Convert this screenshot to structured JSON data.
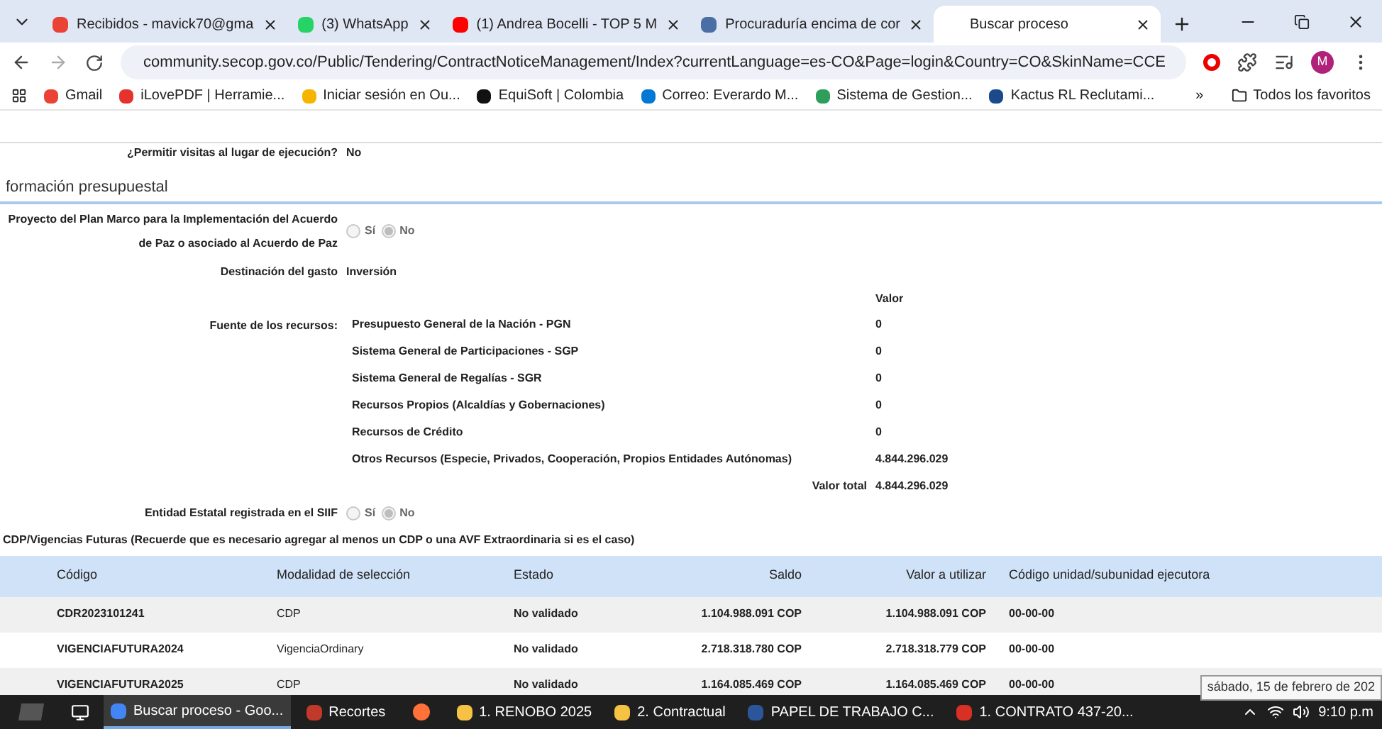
{
  "browser": {
    "tabs": [
      {
        "title": "Recibidos - mavick70@gma",
        "selected": false
      },
      {
        "title": "(3) WhatsApp",
        "selected": false
      },
      {
        "title": "(1) Andrea Bocelli - TOP 5 M",
        "selected": false
      },
      {
        "title": "Procuraduría encima de cor",
        "selected": false
      },
      {
        "title": "Buscar proceso",
        "selected": true
      }
    ],
    "url": "community.secop.gov.co/Public/Tendering/ContractNoticeManagement/Index?currentLanguage=es-CO&Page=login&Country=CO&SkinName=CCE",
    "profile_initial": "M",
    "bookmarks": [
      "Gmail",
      "iLovePDF | Herramie...",
      "Iniciar sesión en Ou...",
      "EquiSoft | Colombia",
      "Correo: Everardo M...",
      "Sistema de Gestion...",
      "Kactus RL Reclutami..."
    ],
    "more_bookmarks": "»",
    "all_bookmarks": "Todos los favoritos"
  },
  "page": {
    "visits": {
      "label": "¿Permitir visitas al lugar de ejecución?",
      "value": "No"
    },
    "section_title": "formación presupuestal",
    "peace_plan": {
      "label_lines": [
        "Proyecto del Plan Marco para la Implementación del Acuerdo",
        "de Paz o asociado al Acuerdo de Paz"
      ],
      "options": [
        {
          "label": "Sí",
          "selected": false
        },
        {
          "label": "No",
          "selected": true
        }
      ]
    },
    "destination": {
      "label": "Destinación del gasto",
      "value": "Inversión"
    },
    "sources": {
      "label": "Fuente de los recursos:",
      "value_header": "Valor",
      "items": [
        {
          "name": "Presupuesto General de la Nación - PGN",
          "value": "0"
        },
        {
          "name": "Sistema General de Participaciones - SGP",
          "value": "0"
        },
        {
          "name": "Sistema General de Regalías - SGR",
          "value": "0"
        },
        {
          "name": "Recursos Propios (Alcaldías y Gobernaciones)",
          "value": "0"
        },
        {
          "name": "Recursos de Crédito",
          "value": "0"
        },
        {
          "name": "Otros Recursos (Especie, Privados, Cooperación, Propios Entidades Autónomas)",
          "value": "4.844.296.029"
        }
      ],
      "total_label": "Valor total",
      "total_value": "4.844.296.029"
    },
    "siif": {
      "label": "Entidad Estatal registrada en el SIIF",
      "options": [
        {
          "label": "Sí",
          "selected": false
        },
        {
          "label": "No",
          "selected": true
        }
      ]
    },
    "cdp_note": "CDP/Vigencias Futuras (Recuerde que es necesario agregar al menos un CDP o una AVF Extraordinaria si es el caso)",
    "table": {
      "columns": [
        "Código",
        "Modalidad de selección",
        "Estado",
        "Saldo",
        "Valor a utilizar",
        "Código unidad/subunidad ejecutora"
      ],
      "rows": [
        [
          "CDR2023101241",
          "CDP",
          "No validado",
          "1.104.988.091 COP",
          "1.104.988.091 COP",
          "00-00-00"
        ],
        [
          "VIGENCIAFUTURA2024",
          "VigenciaOrdinary",
          "No validado",
          "2.718.318.780 COP",
          "2.718.318.779 COP",
          "00-00-00"
        ],
        [
          "VIGENCIAFUTURA2025",
          "CDP",
          "No validado",
          "1.164.085.469 COP",
          "1.164.085.469 COP",
          "00-00-00"
        ]
      ]
    }
  },
  "tooltip": "sábado, 15 de febrero de 202",
  "taskbar": {
    "items": [
      {
        "title": "Buscar proceso - Goo...",
        "selected": true
      },
      {
        "title": "Recortes",
        "selected": false
      },
      {
        "title": "1. RENOBO 2025",
        "selected": false
      },
      {
        "title": "2. Contractual",
        "selected": false
      },
      {
        "title": "PAPEL DE TRABAJO C...",
        "selected": false
      },
      {
        "title": "1. CONTRATO 437-20...",
        "selected": false
      }
    ],
    "clock": "9:10 p.m"
  }
}
